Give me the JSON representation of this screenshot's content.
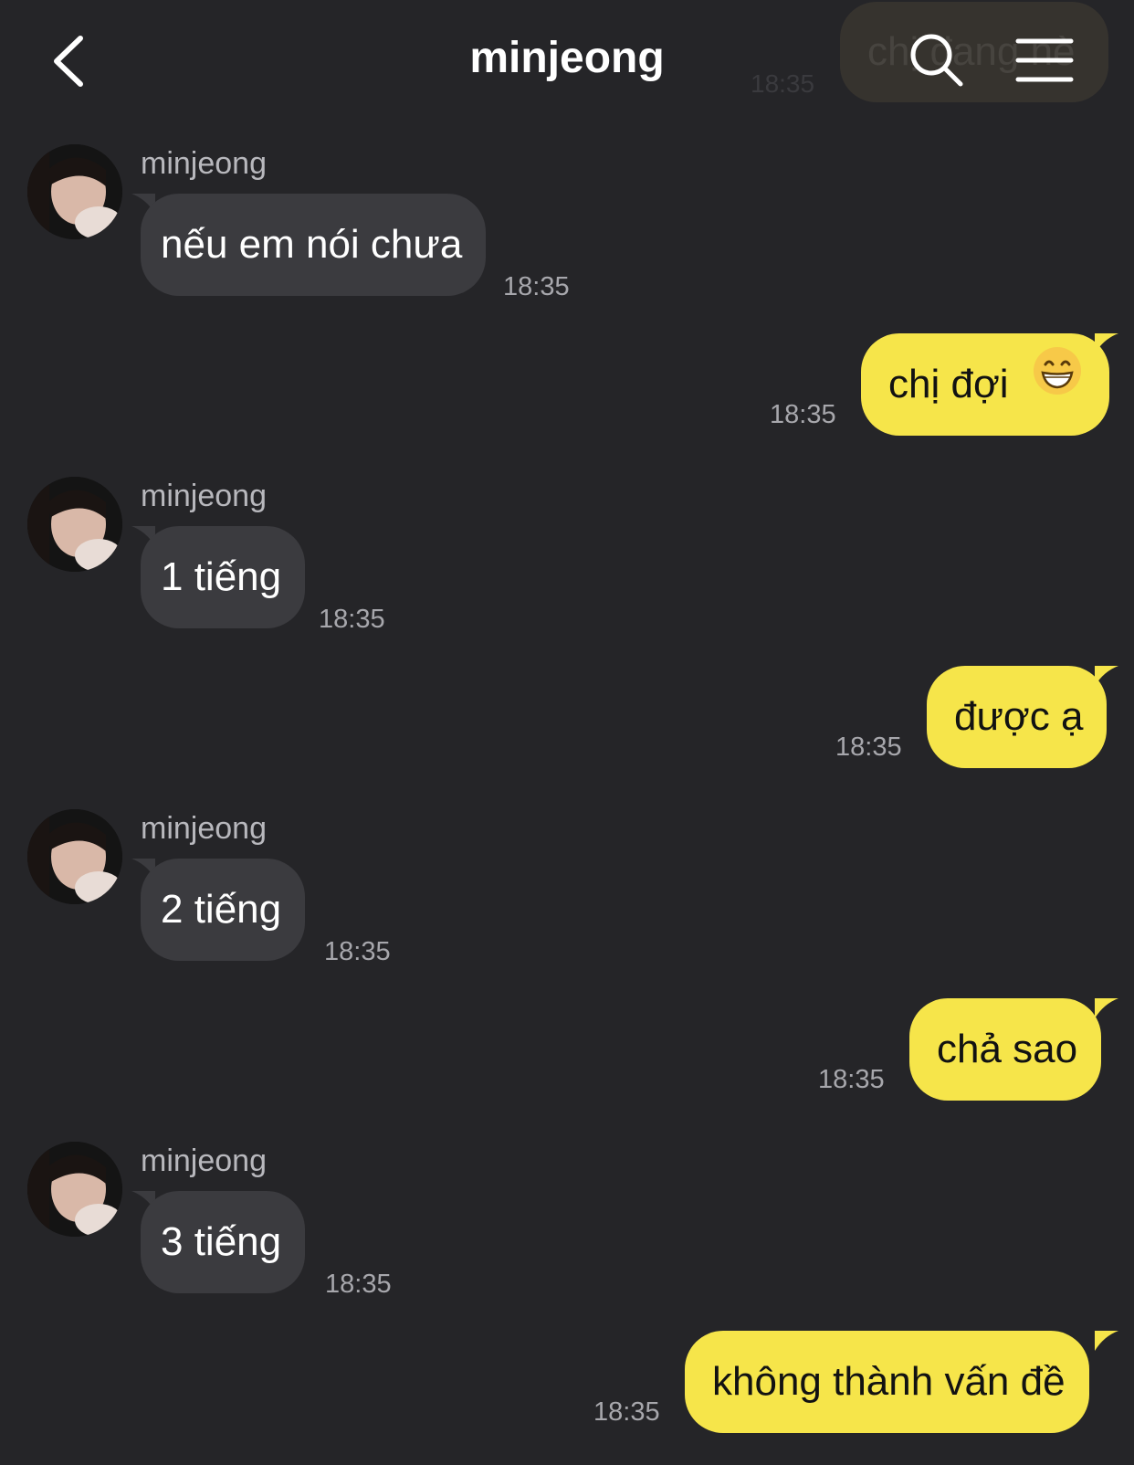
{
  "header": {
    "title": "minjeong",
    "ghost_text": "chị đang nè",
    "ghost_time": "18:35"
  },
  "messages": [
    {
      "side": "in",
      "sender": "minjeong",
      "text": "nếu em nói chưa",
      "time": "18:35"
    },
    {
      "side": "out",
      "text": "chị đợi",
      "emoji": "😁",
      "time": "18:35"
    },
    {
      "side": "in",
      "sender": "minjeong",
      "text": "1 tiếng",
      "time": "18:35"
    },
    {
      "side": "out",
      "text": "được ạ",
      "time": "18:35"
    },
    {
      "side": "in",
      "sender": "minjeong",
      "text": "2 tiếng",
      "time": "18:35"
    },
    {
      "side": "out",
      "text": "chả sao",
      "time": "18:35"
    },
    {
      "side": "in",
      "sender": "minjeong",
      "text": "3 tiếng",
      "time": "18:35"
    },
    {
      "side": "out",
      "text": "không thành vấn đề",
      "time": "18:35"
    }
  ],
  "colors": {
    "background": "#252528",
    "incoming_bubble": "#3b3b3f",
    "outgoing_bubble": "#f6e54a"
  }
}
